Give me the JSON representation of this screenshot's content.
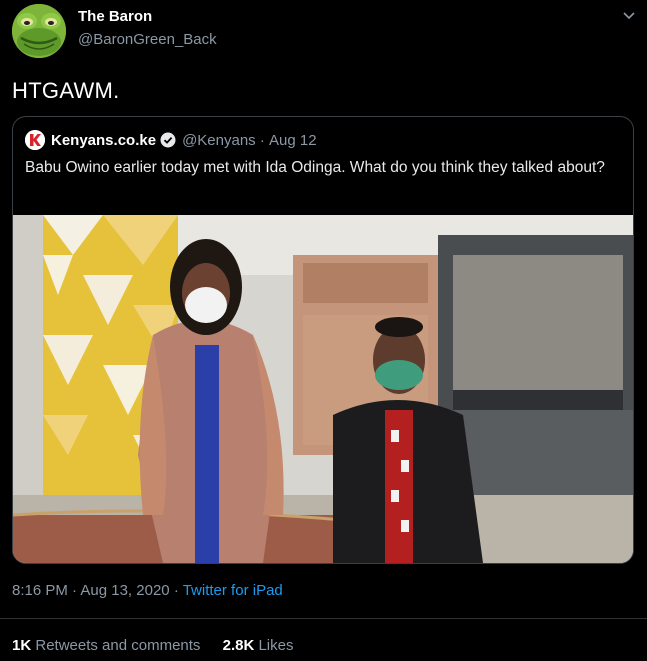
{
  "user": {
    "display_name": "The Baron",
    "handle": "@BaronGreen_Back",
    "avatar_icon": "frog-avatar-icon"
  },
  "tweet": {
    "text": "HTGAWM.",
    "time": "8:16 PM",
    "date": "Aug 13, 2020",
    "source": "Twitter for iPad"
  },
  "quoted_tweet": {
    "account_name": "Kenyans.co.ke",
    "handle": "@Kenyans",
    "date": "Aug 12",
    "text": "Babu Owino earlier today met with Ida Odinga. What do you think they talked about?",
    "logo_icon": "kenyans-logo-icon",
    "verified_icon": "verified-badge-icon"
  },
  "stats": {
    "retweets_count": "1K",
    "retweets_label": "Retweets and comments",
    "likes_count": "2.8K",
    "likes_label": "Likes"
  },
  "colors": {
    "background": "#000000",
    "link": "#1d9bf0",
    "muted": "#8b98a5",
    "border": "#3b4045"
  }
}
